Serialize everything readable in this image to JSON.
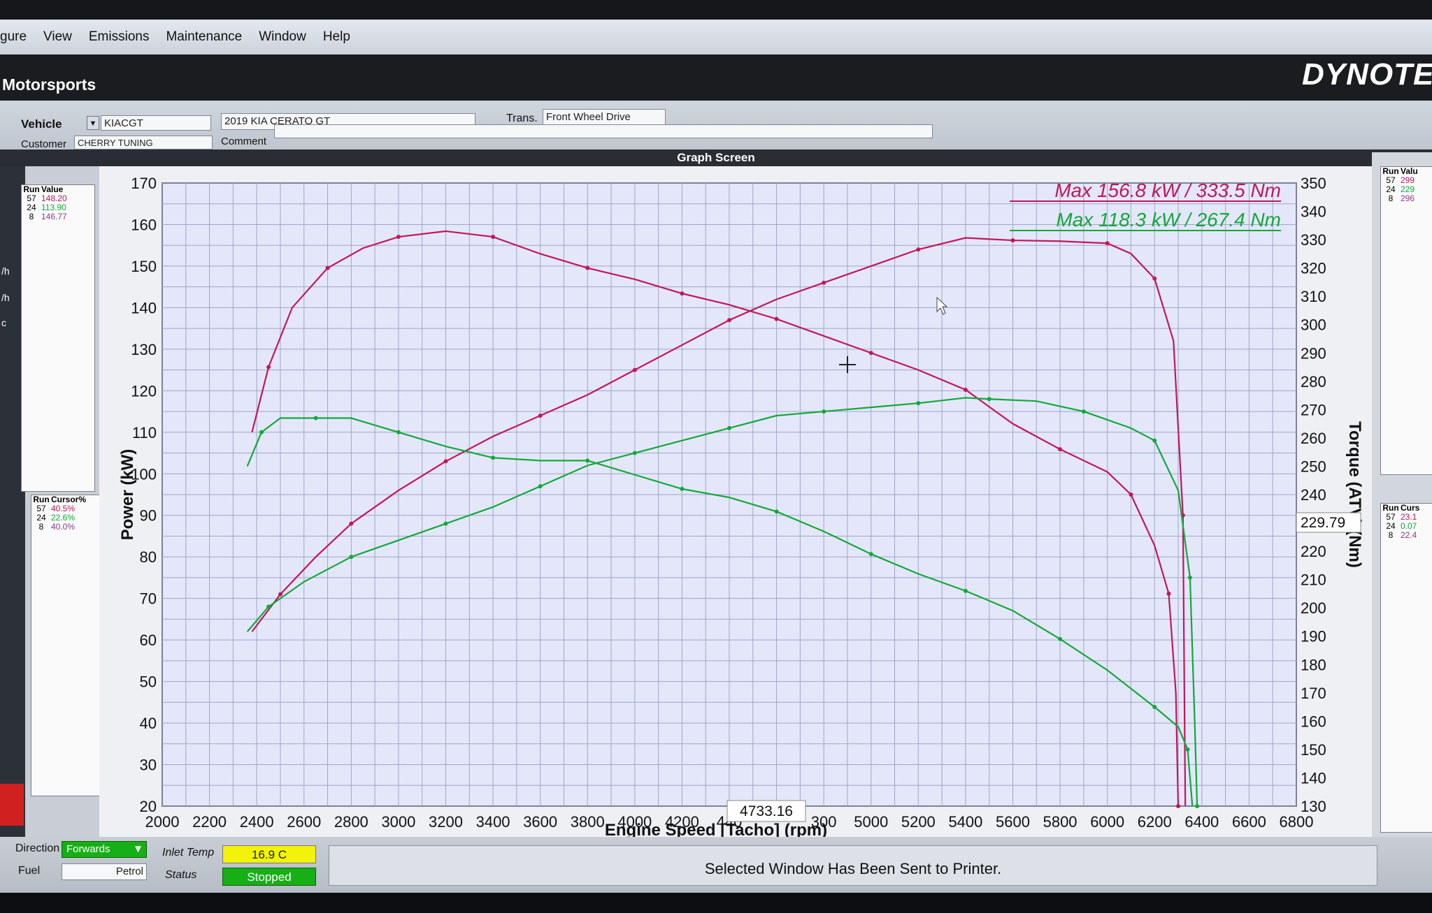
{
  "menu": [
    "gure",
    "View",
    "Emissions",
    "Maintenance",
    "Window",
    "Help"
  ],
  "app": {
    "title": "Motorsports",
    "logo": "DYNOTEC"
  },
  "vehicle": {
    "label": "Vehicle",
    "id": "KIACGT",
    "description": "2019 KIA CERATO GT",
    "trans_label": "Trans.",
    "trans": "Front Wheel Drive",
    "customer_label": "Customer",
    "customer": "CHERRY TUNING",
    "comment_label": "Comment",
    "comment": ""
  },
  "graph_screen": {
    "title": "Graph Screen"
  },
  "left_strip_labels": [
    "/h",
    "/h",
    "c"
  ],
  "value_table": {
    "headers": [
      "Run",
      "Value"
    ],
    "rows": [
      {
        "run": "57",
        "value": "148.20"
      },
      {
        "run": "24",
        "value": "113.90"
      },
      {
        "run": "8",
        "value": "146.77"
      }
    ]
  },
  "cursor_table": {
    "headers": [
      "Run",
      "Cursor%"
    ],
    "rows": [
      {
        "run": "57",
        "value": "40.5%"
      },
      {
        "run": "24",
        "value": "22.6%"
      },
      {
        "run": "8",
        "value": "40.0%"
      }
    ]
  },
  "right_value_table": {
    "headers": [
      "Run",
      "Valu"
    ],
    "rows": [
      {
        "run": "57",
        "value": "299"
      },
      {
        "run": "24",
        "value": "229"
      },
      {
        "run": "8",
        "value": "296"
      }
    ]
  },
  "right_cursor_table": {
    "headers": [
      "Run",
      "Curs"
    ],
    "rows": [
      {
        "run": "57",
        "value": "23.1"
      },
      {
        "run": "24",
        "value": "0.07"
      },
      {
        "run": "8",
        "value": "22.4"
      }
    ]
  },
  "colors": {
    "red_series": "#c2175a",
    "green_series": "#12a83a",
    "plot_bg": "#e4e7fa"
  },
  "chart_data": {
    "type": "line",
    "xlabel": "Engine Speed [Tacho] (rpm)",
    "ylabel": "Power (kW)",
    "y2label": "Torque (ATV) (Nm)",
    "xlim": [
      2000,
      6800
    ],
    "ylim": [
      20,
      170
    ],
    "y2lim": [
      130,
      350
    ],
    "x_ticks": [
      2000,
      2200,
      2400,
      2600,
      2800,
      3000,
      3200,
      3400,
      3600,
      3800,
      4000,
      4200,
      4400,
      4600,
      4800,
      5000,
      5200,
      5400,
      5600,
      5800,
      6000,
      6200,
      6400,
      6600,
      6800
    ],
    "x_tick_labels": [
      "2000",
      "2200",
      "2400",
      "2600",
      "2800",
      "3000",
      "3200",
      "3400",
      "3600",
      "3800",
      "4000",
      "4200",
      "440",
      "",
      "300",
      "5000",
      "5200",
      "5400",
      "5600",
      "5800",
      "6000",
      "6200",
      "6400",
      "6600",
      "6800"
    ],
    "y_ticks": [
      20,
      30,
      40,
      50,
      60,
      70,
      80,
      90,
      100,
      110,
      120,
      130,
      140,
      150,
      160,
      170
    ],
    "y2_ticks": [
      130,
      140,
      150,
      160,
      170,
      180,
      190,
      200,
      210,
      220,
      230,
      240,
      250,
      260,
      270,
      280,
      290,
      300,
      310,
      320,
      330,
      340,
      350
    ],
    "grid": true,
    "annotations": [
      {
        "text": "Max 156.8 kW  / 333.5 Nm",
        "color": "red"
      },
      {
        "text": "Max 118.3 kW  / 267.4 Nm",
        "color": "green"
      }
    ],
    "cursor_x_readout": "4733.16",
    "cursor_y_readout": "229.79",
    "series": [
      {
        "color": "red",
        "axis": "power",
        "kind": "Power",
        "x": [
          2380,
          2500,
          2650,
          2800,
          3000,
          3200,
          3400,
          3600,
          3800,
          4000,
          4200,
          4400,
          4600,
          4800,
          5000,
          5200,
          5400,
          5600,
          5800,
          6000,
          6100,
          6200,
          6280,
          6320,
          6330
        ],
        "y": [
          62,
          71,
          80,
          88,
          96,
          103,
          109,
          114,
          119,
          125,
          131,
          137,
          142,
          146,
          150,
          154,
          156.8,
          156.2,
          156,
          155.5,
          153,
          147,
          132,
          90,
          20
        ]
      },
      {
        "color": "red",
        "axis": "torque",
        "kind": "Torque",
        "x": [
          2380,
          2450,
          2550,
          2700,
          2850,
          3000,
          3200,
          3400,
          3600,
          3800,
          4000,
          4200,
          4400,
          4600,
          4800,
          5000,
          5200,
          5400,
          5600,
          5800,
          6000,
          6100,
          6200,
          6260,
          6290,
          6300
        ],
        "y": [
          262,
          285,
          306,
          320,
          327,
          331,
          333,
          331,
          325,
          320,
          316,
          311,
          307,
          302,
          296,
          290,
          284,
          277,
          265,
          256,
          248,
          240,
          222,
          205,
          170,
          130
        ]
      },
      {
        "color": "green",
        "axis": "power",
        "kind": "Power",
        "x": [
          2360,
          2450,
          2600,
          2800,
          3000,
          3200,
          3400,
          3600,
          3800,
          4000,
          4200,
          4400,
          4600,
          4800,
          5000,
          5200,
          5400,
          5500,
          5700,
          5900,
          6100,
          6200,
          6300,
          6350,
          6370,
          6380
        ],
        "y": [
          62,
          68,
          74,
          80,
          84,
          88,
          92,
          97,
          102,
          105,
          108,
          111,
          114,
          115,
          116,
          117,
          118.3,
          118,
          117.5,
          115,
          111,
          108,
          96,
          75,
          40,
          20
        ]
      },
      {
        "color": "green",
        "axis": "torque",
        "kind": "Torque",
        "x": [
          2360,
          2420,
          2500,
          2650,
          2800,
          3000,
          3200,
          3400,
          3600,
          3800,
          4000,
          4200,
          4400,
          4600,
          4800,
          5000,
          5200,
          5400,
          5600,
          5800,
          6000,
          6200,
          6300,
          6340,
          6360
        ],
        "y": [
          250,
          262,
          267,
          267,
          267,
          262,
          257,
          253,
          252,
          252,
          247,
          242,
          239,
          234,
          227,
          219,
          212,
          206,
          199,
          189,
          178,
          165,
          158,
          150,
          130
        ]
      }
    ]
  },
  "status": {
    "direction_label": "Direction",
    "direction": "Forwards",
    "fuel_label": "Fuel",
    "fuel": "Petrol",
    "inlet_label": "Inlet Temp",
    "inlet": "16.9 C",
    "status_label": "Status",
    "status": "Stopped",
    "message": "Selected Window Has Been Sent to Printer."
  }
}
